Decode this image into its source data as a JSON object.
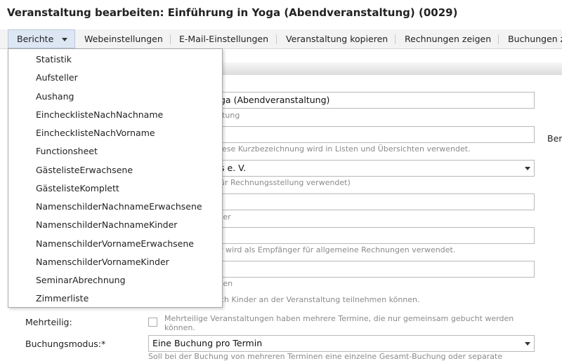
{
  "page_title": "Veranstaltung bearbeiten: Einführung in Yoga (Abendveranstaltung) (0029)",
  "toolbar": {
    "items": [
      "Berichte",
      "Webeinstellungen",
      "E-Mail-Einstellungen",
      "Veranstaltung kopieren",
      "Rechnungen zeigen",
      "Buchungen z"
    ]
  },
  "reports_menu": {
    "items": [
      "Statistik",
      "Aufsteller",
      "Aushang",
      "EincheckIisteNachNachname",
      "EincheckIisteNachVorname",
      "Functionsheet",
      "GästelisteErwachsene",
      "GästelisteKomplett",
      "NamenschilderNachnameErwachsene",
      "NamenschilderNachnameKinder",
      "NamenschilderVornameErwachsene",
      "NamenschilderVornameKinder",
      "SeminarAbrechnung",
      "Zimmerliste"
    ]
  },
  "form": {
    "title_value": "ga (Abendveranstaltung)",
    "title_hint": "ltung",
    "short_hint": "iese Kurzbezeichnung wird in Listen und Übersichten verwendet.",
    "side_label": "Ber",
    "org_value": "s e. V.",
    "org_hint": "ür Rechnungsstellung verwendet)",
    "field4_hint": "ter",
    "field5_hint": "r wird als Empfänger für allgemeine Rechnungen verwendet.",
    "field6_hint": "ten",
    "children_hint": "ch Kinder an der Veranstaltung teilnehmen können.",
    "mehrteilig_label": "Mehrteilig:",
    "mehrteilig_hint_1": "Mehrteilige Veranstaltungen haben mehrere Termine, die nur gemeinsam gebucht werden",
    "mehrteilig_hint_2": "können.",
    "buchungsmodus_label": "Buchungsmodus:*",
    "buchungsmodus_value": "Eine Buchung pro Termin",
    "buchungsmodus_hint": "Soll bei der Buchung von mehreren Terminen eine einzelne Gesamt-Buchung oder separate"
  }
}
